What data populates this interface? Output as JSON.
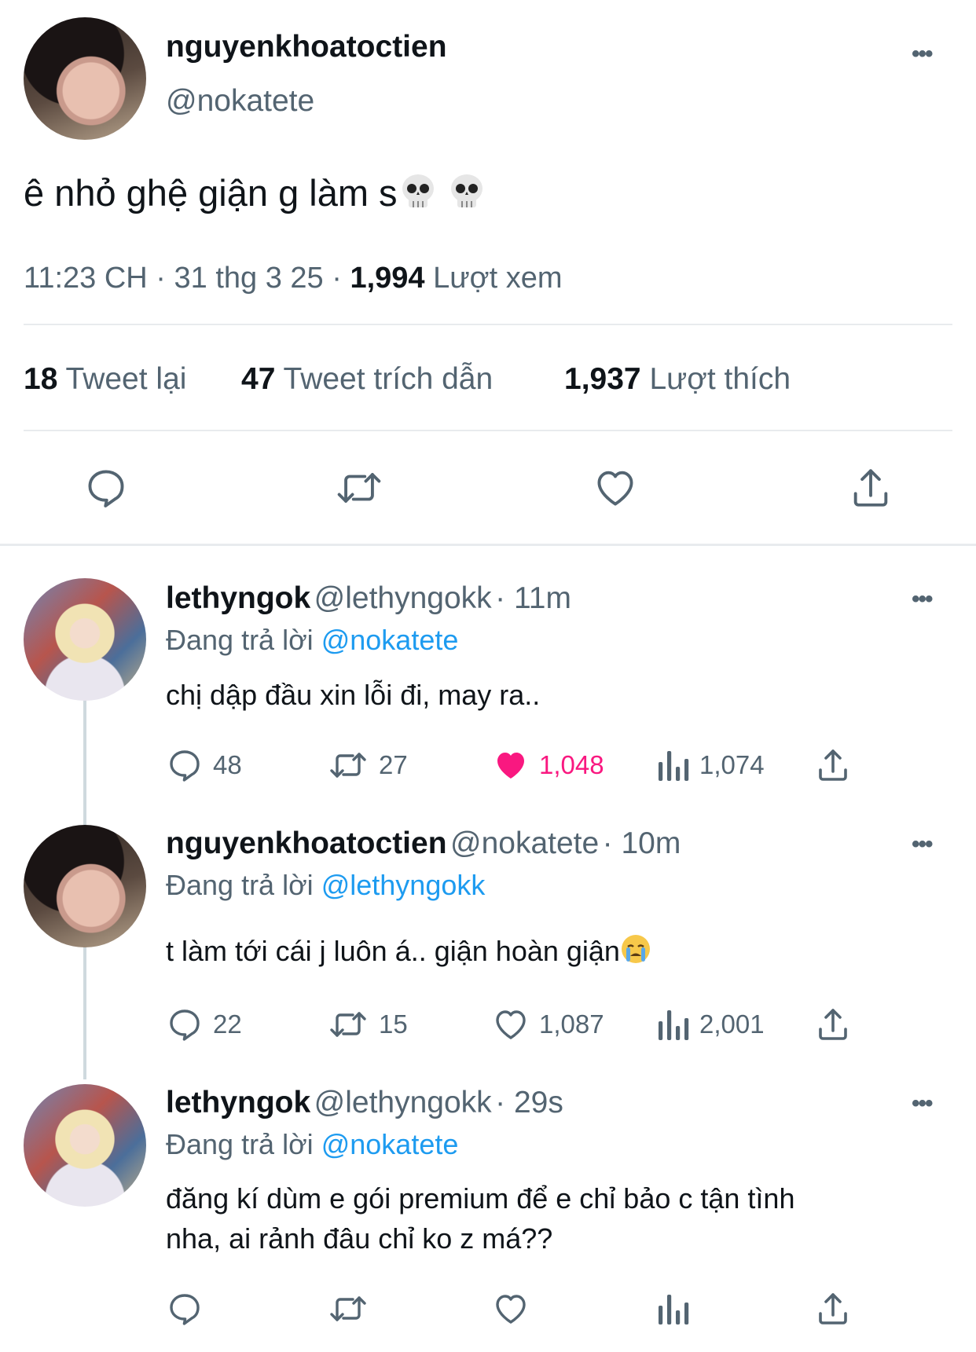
{
  "main_tweet": {
    "display_name": "nguyenkhoatoctien",
    "handle": "@nokatete",
    "text": "ê nhỏ ghệ giận g làm s",
    "time": "11:23 CH",
    "date": "31 thg 3 25",
    "views_count": "1,994",
    "views_label": "Lượt xem",
    "retweets_count": "18",
    "retweets_label": "Tweet lại",
    "quotes_count": "47",
    "quotes_label": "Tweet trích dẫn",
    "likes_count": "1,937",
    "likes_label": "Lượt thích",
    "separator": "·"
  },
  "replies": [
    {
      "display_name": "lethyngok",
      "handle": "@lethyngokk",
      "time": "· 11m",
      "replying_label": "Đang trả lời",
      "replying_to": "@nokatete",
      "text": "chị dập đầu xin lỗi đi, may ra..",
      "replies": "48",
      "retweets": "27",
      "likes": "1,048",
      "views": "1,074",
      "liked": true
    },
    {
      "display_name": "nguyenkhoatoctien",
      "handle": "@nokatete",
      "time": "· 10m",
      "replying_label": "Đang trả lời",
      "replying_to": "@lethyngokk",
      "text": "t làm tới cái j luôn á.. giận hoàn giận",
      "replies": "22",
      "retweets": "15",
      "likes": "1,087",
      "views": "2,001",
      "liked": false
    },
    {
      "display_name": "lethyngok",
      "handle": "@lethyngokk",
      "time": "· 29s",
      "replying_label": "Đang trả lời",
      "replying_to": "@nokatete",
      "text_line1": "đăng kí dùm e gói premium để e chỉ bảo c tận tình",
      "text_line2": "nha, ai rảnh đâu chỉ ko z má??",
      "liked": false
    }
  ],
  "icons": {
    "more": "more-icon",
    "reply": "reply-icon",
    "retweet": "retweet-icon",
    "like": "heart-icon",
    "share": "share-icon",
    "views": "views-icon",
    "skull": "skull-emoji",
    "crying": "crying-emoji"
  },
  "colors": {
    "text": "#0f1419",
    "secondary": "#536471",
    "link": "#1d9bf0",
    "like": "#f91880",
    "divider": "#e8ebee"
  }
}
